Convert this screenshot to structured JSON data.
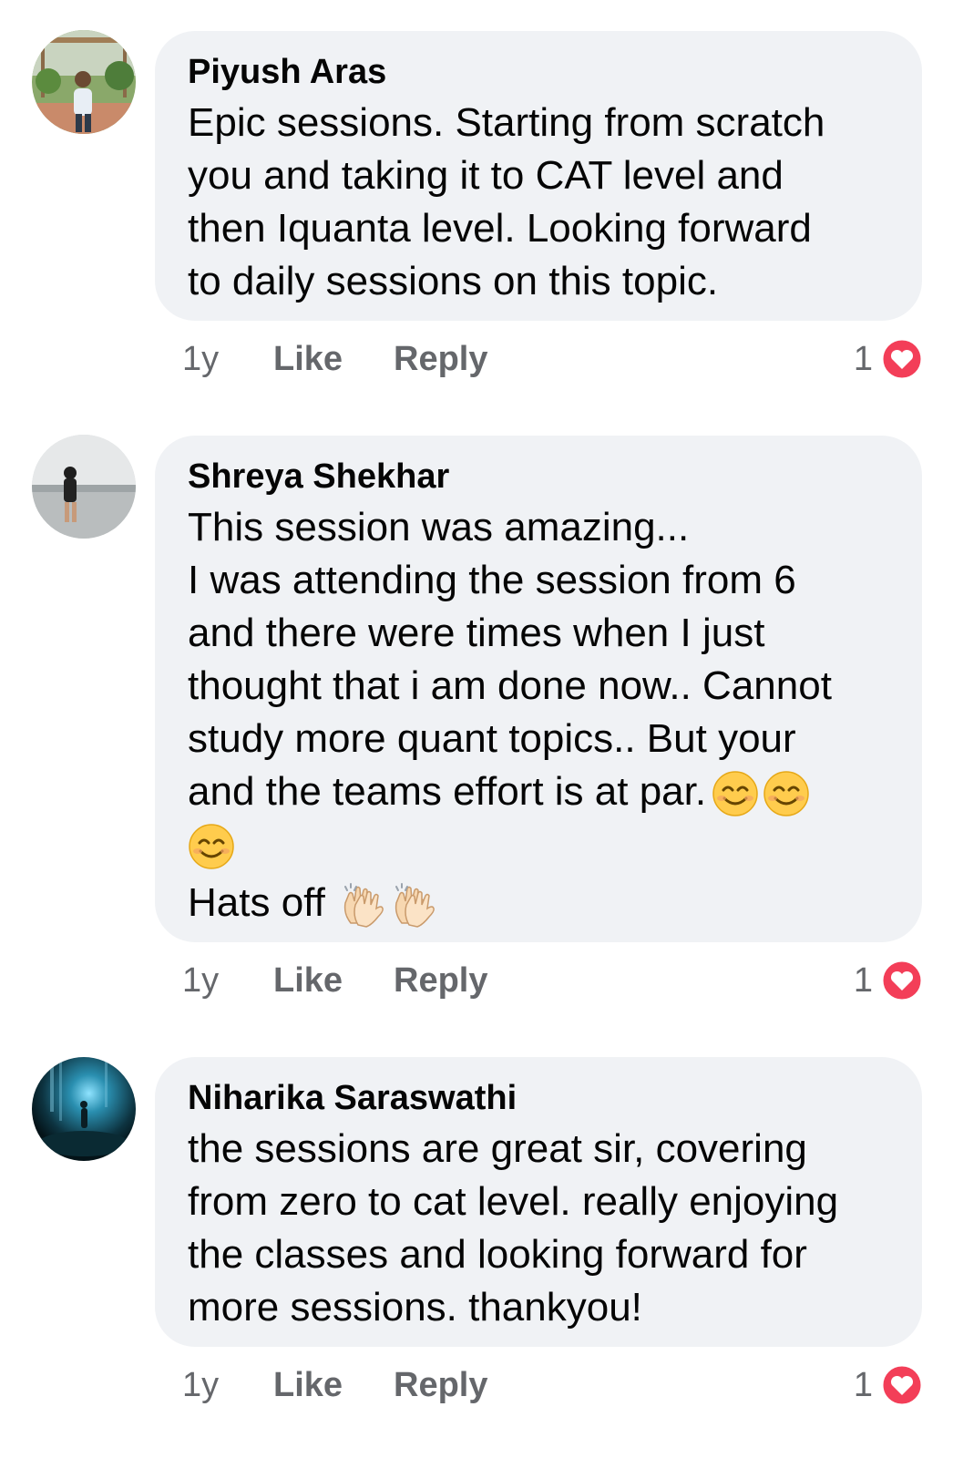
{
  "colors": {
    "bubble_bg": "#f0f2f5",
    "meta_text": "#65676b",
    "heart": "#f33e58"
  },
  "comments": [
    {
      "author": "Piyush Aras",
      "lines": [
        "Epic sessions. Starting from scratch",
        "you and taking it to CAT level and",
        "then Iquanta level. Looking forward",
        "to daily sessions on this topic."
      ],
      "time": "1y",
      "like_label": "Like",
      "reply_label": "Reply",
      "reaction_count": "1",
      "reaction_icon": "heart-icon"
    },
    {
      "author": "Shreya Shekhar",
      "lines": [
        "This session was amazing...",
        "I was attending the session from 6",
        "and there were times when I just",
        "thought that i am done now.. Cannot",
        "study more quant topics.. But your",
        "and the teams effort is at par."
      ],
      "line_emojis": "smiling-face-emoji ×2",
      "wrapped_emoji": "smiling-face-emoji",
      "last_line": "Hats off",
      "last_line_emojis": "clapping-hands-emoji ×2",
      "time": "1y",
      "like_label": "Like",
      "reply_label": "Reply",
      "reaction_count": "1",
      "reaction_icon": "heart-icon"
    },
    {
      "author": "Niharika Saraswathi",
      "lines": [
        "the sessions are great sir, covering",
        "from zero to cat level. really enjoying",
        "the classes and looking forward for",
        "more sessions. thankyou!"
      ],
      "time": "1y",
      "like_label": "Like",
      "reply_label": "Reply",
      "reaction_count": "1",
      "reaction_icon": "heart-icon"
    }
  ]
}
